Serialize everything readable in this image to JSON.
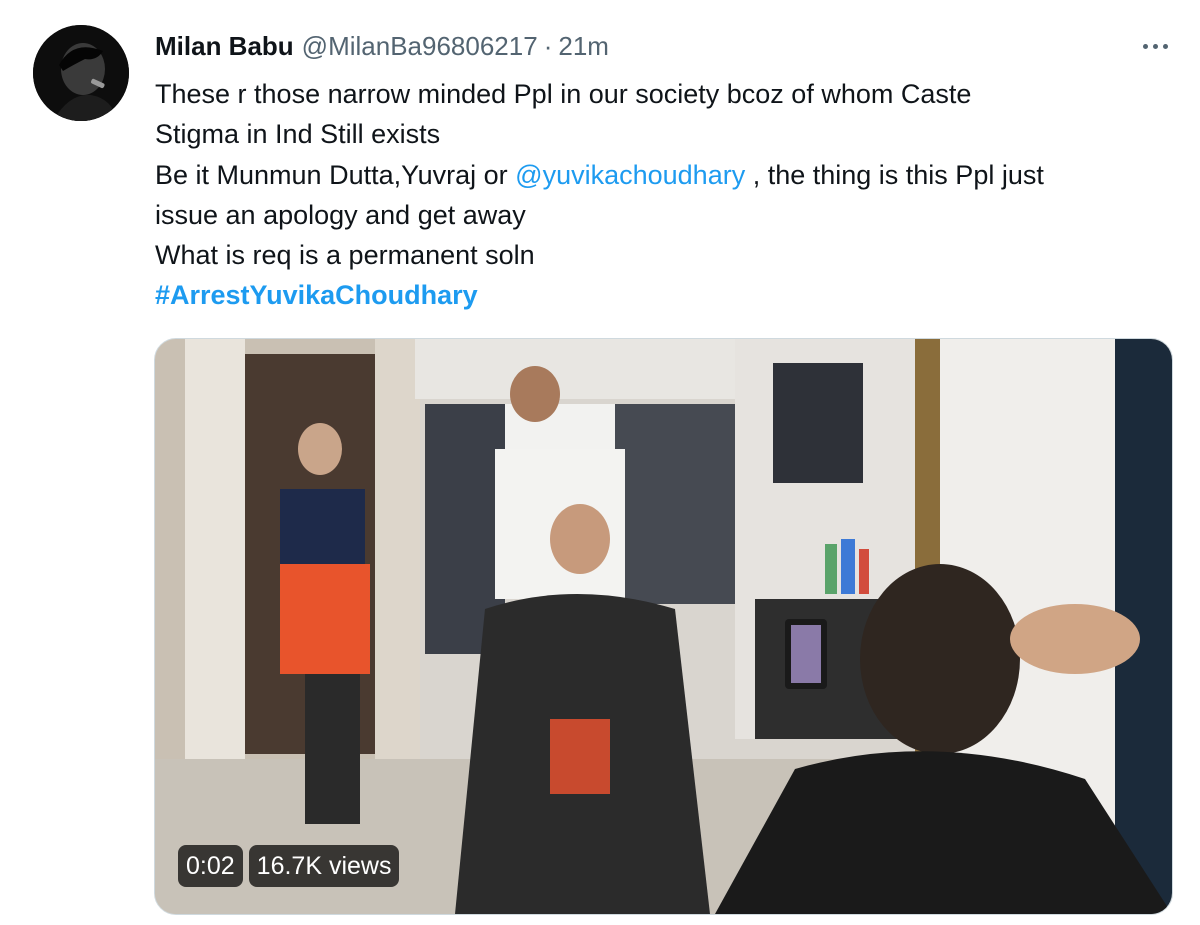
{
  "tweet": {
    "author_name": "Milan Babu",
    "author_handle": "@MilanBa96806217",
    "separator": "·",
    "time": "21m",
    "text": {
      "line1": "These r those narrow minded Ppl in our society bcoz of whom  Caste",
      "line2": "Stigma in Ind Still exists",
      "line3_before": "Be it Munmun Dutta,Yuvraj or ",
      "line3_mention": "@yuvikachoudhary",
      "line3_after": " , the thing is this Ppl just",
      "line4": "issue an apology and get away",
      "line5": "What is req is a permanent soln",
      "hashtag": "#ArrestYuvikaChoudhary"
    },
    "media": {
      "type": "video",
      "duration": "0:02",
      "views": "16.7K views"
    }
  },
  "icons": {
    "more": "more-horizontal-icon",
    "avatar": "avatar"
  },
  "colors": {
    "link": "#1d9bf0",
    "text": "#0f1419",
    "secondary": "#536471"
  }
}
